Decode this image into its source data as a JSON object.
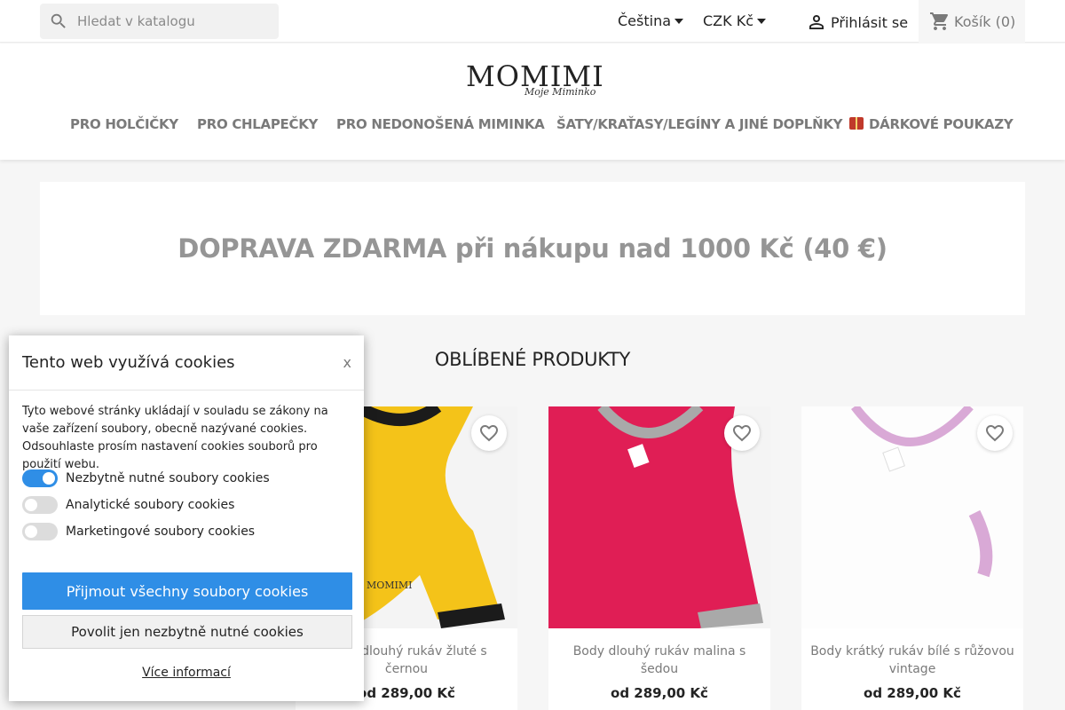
{
  "search": {
    "placeholder": "Hledat v katalogu"
  },
  "header": {
    "language": "Čeština",
    "currency": "CZK Kč",
    "login": "Přihlásit se",
    "cart": "Košík (0)",
    "logo_main": "MOMIMI",
    "logo_sub": "Moje Miminko"
  },
  "nav": {
    "items": [
      {
        "label": "PRO HOLČIČKY"
      },
      {
        "label": "PRO CHLAPEČKY"
      },
      {
        "label": "PRO NEDONOŠENÁ MIMINKA"
      },
      {
        "label": "ŠATY/KRAŤASY/LEGÍNY A JINÉ DOPLŇKY"
      },
      {
        "label": "DÁRKOVÉ POUKAZY"
      }
    ]
  },
  "banner": {
    "text": "DOPRAVA ZDARMA při nákupu nad 1000 Kč (40 €)"
  },
  "section_title": "OBLÍBENÉ PRODUKTY",
  "products": [
    {
      "name": "Body dlouhý rukáv žluté s černou",
      "price": "od 289,00 Kč"
    },
    {
      "name": "Body dlouhý rukáv malina s šedou",
      "price": "od 289,00 Kč"
    },
    {
      "name": "Body krátký rukáv bílé s růžovou vintage",
      "price": "od 289,00 Kč"
    }
  ],
  "cookie": {
    "title": "Tento web využívá cookies",
    "close": "x",
    "description": "Tyto webové stránky ukládají v souladu se zákony na vaše zařízení soubory, obecně nazývané cookies. Odsouhlaste prosím nastavení cookies souborů pro použití webu.",
    "toggles": [
      {
        "label": "Nezbytně nutné soubory cookies",
        "on": true
      },
      {
        "label": "Analytické soubory cookies",
        "on": false
      },
      {
        "label": "Marketingové soubory cookies",
        "on": false
      }
    ],
    "accept_all": "Přijmout všechny soubory cookies",
    "necessary_only": "Povolit jen nezbytně nutné cookies",
    "more_info": "Více informací"
  },
  "colors": {
    "accent": "#2f8ee6",
    "text_muted": "#7a7a7a",
    "background": "#f6f6f6"
  }
}
